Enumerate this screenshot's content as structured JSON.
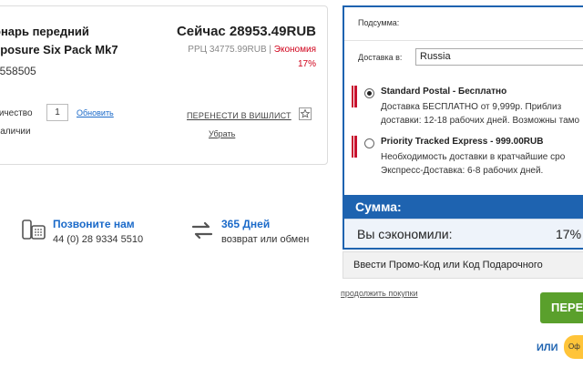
{
  "product": {
    "name_line1": "онарь передний",
    "name_line2": "xposure Six Pack Mk7",
    "code": "#558505",
    "price_now": "Сейчас 28953.49RUB",
    "rrp": "РРЦ 34775.99RUB |",
    "savings_label": "Экономия",
    "savings_pct": "17%",
    "qty_label": "личество",
    "qty_value": "1",
    "update_label": "Обновить",
    "stock_status": "Наличии",
    "wishlist_label": "ПЕРЕНЕСТИ В ВИШЛИСТ",
    "remove_label": "Убрать"
  },
  "contact": {
    "call_title": "Позвоните нам",
    "call_number": "44 (0) 28 9334 5510",
    "returns_title": "365 Дней",
    "returns_sub": "возврат или обмен"
  },
  "summary": {
    "subtotal_label": "Подсумма:",
    "delivery_label": "Доставка в:",
    "country": "Russia",
    "options": [
      {
        "title": "Standard Postal  -  Бесплатно",
        "line1": "Доставка БЕСПЛАТНО от 9,999р. Приблиз",
        "line2": "доставки: 12-18 рабочих дней. Возможны тамо",
        "selected": true
      },
      {
        "title": "Priority Tracked Express  -  999.00RUB",
        "line1": "Необходимость доставки в кратчайшие сро",
        "line2": "Экспресс-Доставка: 6-8 рабочих дней.",
        "selected": false
      }
    ],
    "total_label": "Сумма:",
    "saved_label": "Вы сэкономили:",
    "saved_pct": "17%",
    "accent_color": "#1e63b0"
  },
  "promo_label": "Ввести Промо-Код или Код Подарочного",
  "continue_label": "продолжить покупки",
  "checkout_label": "ПЕРЕ",
  "or_label": "ИЛИ",
  "alt_pay_label": "Оф"
}
